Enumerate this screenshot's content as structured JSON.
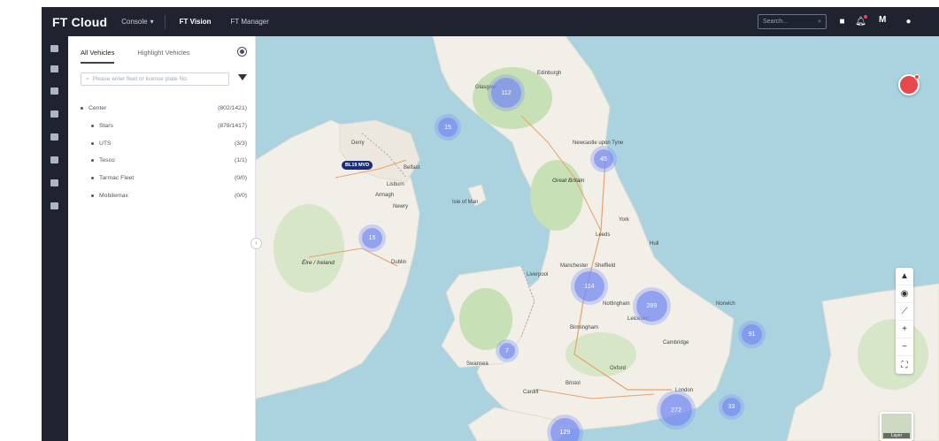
{
  "topbar": {
    "brand": "FT Cloud",
    "console": "Console",
    "nav": [
      "FT Vision",
      "FT Manager"
    ],
    "search_placeholder": "Search...",
    "user_initial": "M"
  },
  "panel": {
    "tabs": [
      "All Vehicles",
      "Highlight Vehicles"
    ],
    "search_placeholder": "Please enter fleet or license plate No.",
    "tree": [
      {
        "name": "Center",
        "count": "(802/1421)",
        "level": 0
      },
      {
        "name": "Stars",
        "count": "(878/1417)",
        "level": 1
      },
      {
        "name": "UTS",
        "count": "(3/3)",
        "level": 1
      },
      {
        "name": "Tesco",
        "count": "(1/1)",
        "level": 1
      },
      {
        "name": "Tarmac Fleet",
        "count": "(0/0)",
        "level": 1
      },
      {
        "name": "Mobilemax",
        "count": "(0/0)",
        "level": 1
      }
    ]
  },
  "map": {
    "vehicle_tag": "BL19 MVD",
    "country_labels": [
      "Great Britain",
      "Éire / Ireland",
      "Isle of Man"
    ],
    "city_labels": [
      "Newcastle upon Tyne",
      "Belfast",
      "Dublin",
      "Manchester",
      "Sheffield",
      "Birmingham",
      "Cambridge",
      "Cardiff",
      "London",
      "Leeds",
      "Lisburn",
      "Armagh",
      "Newry",
      "Derry",
      "Swansea",
      "Bristol",
      "Oxford",
      "Norwich",
      "Nottingham",
      "Leicester",
      "Liverpool",
      "Glasgow",
      "Edinburgh",
      "York",
      "Hull"
    ],
    "clusters": [
      {
        "label": "112",
        "size": "large"
      },
      {
        "label": "15",
        "size": "small"
      },
      {
        "label": "45",
        "size": "small"
      },
      {
        "label": "15",
        "size": "small"
      },
      {
        "label": "114",
        "size": "large"
      },
      {
        "label": "289",
        "size": "large"
      },
      {
        "label": "91",
        "size": "small"
      },
      {
        "label": "7",
        "size": "small"
      },
      {
        "label": "272",
        "size": "large"
      },
      {
        "label": "33",
        "size": "small"
      },
      {
        "label": "129",
        "size": "large"
      }
    ],
    "layer_label": "Layer",
    "colors": {
      "sea": "#aad3df",
      "land": "#f2efe9",
      "green": "#c8e0b5",
      "cluster": "#7b8cf0",
      "alert": "#e5484d"
    }
  }
}
